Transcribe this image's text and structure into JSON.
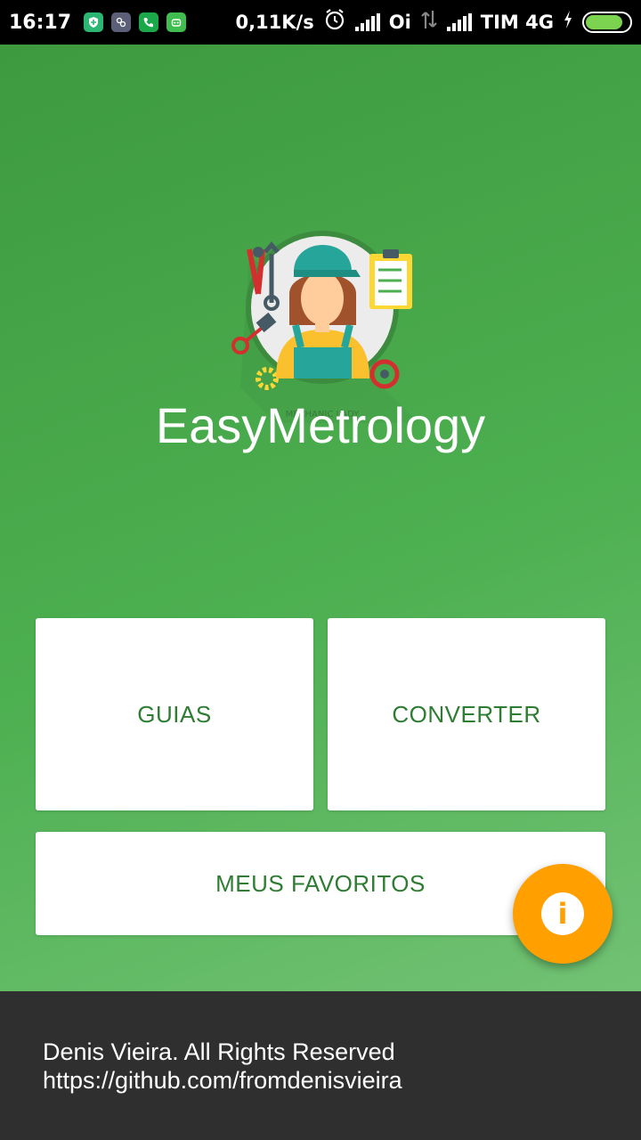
{
  "status_bar": {
    "time": "16:17",
    "net_speed": "0,11K/s",
    "carrier1": "Oi",
    "carrier2": "TIM 4G",
    "icons": [
      "shield-icon",
      "app-icon",
      "phone-icon",
      "android-icon",
      "alarm-icon",
      "signal-icon",
      "data-arrows-icon",
      "charging-icon",
      "battery-icon"
    ],
    "battery_level": 0.85
  },
  "app": {
    "title": "EasyMetrology",
    "logo_caption": "MECHANIC LADY"
  },
  "menu": {
    "guias": "GUIAS",
    "converter": "CONVERTER",
    "favoritos": "MEUS FAVORITOS"
  },
  "fab": {
    "label": "i",
    "icon": "info-icon"
  },
  "footer": {
    "line1": "Denis Vieira. All Rights Reserved",
    "line2": "https://github.com/fromdenisvieira"
  },
  "colors": {
    "primary_green": "#4caf50",
    "accent_orange": "#ffa000",
    "text_green": "#2e7d32",
    "footer_bg": "#2f2f2f"
  }
}
